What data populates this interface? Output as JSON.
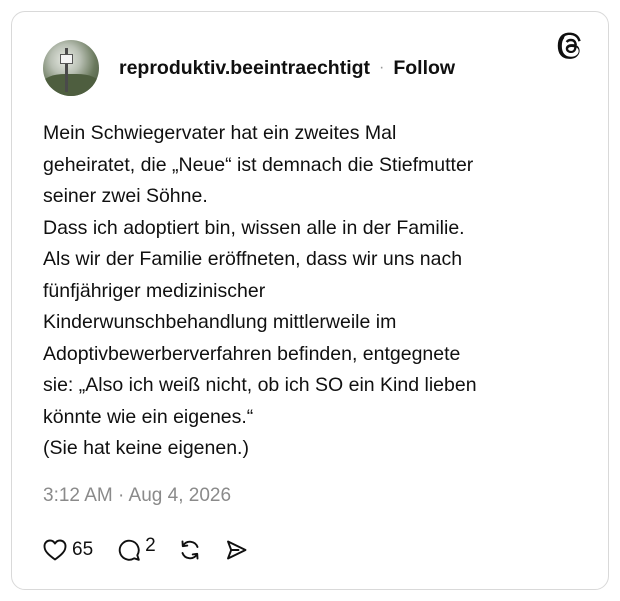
{
  "post": {
    "username": "reproduktiv.beeintraechtigt",
    "separator": "·",
    "follow_label": "Follow",
    "text": "Mein Schwiegervater hat ein zweites Mal\ngeheiratet, die „Neue“ ist demnach die Stiefmutter\nseiner zwei Söhne.\nDass ich adoptiert bin, wissen alle in der Familie.\nAls wir der Familie eröffneten, dass wir uns nach\nfünfjähriger medizinischer\nKinderwunschbehandlung mittlerweile im\nAdoptivbewerberverfahren befinden, entgegnete\nsie: „Also ich weiß nicht, ob ich SO ein Kind lieben\nkönnte wie ein eigenes.“\n(Sie hat keine eigenen.)",
    "timestamp": "3:12 AM · Aug 4, 2026"
  },
  "actions": {
    "likes": "65",
    "replies": "2"
  },
  "icons": {
    "logo": "threads-logo-icon",
    "like": "heart-icon",
    "reply": "comment-icon",
    "repost": "repost-icon",
    "share": "send-icon"
  }
}
